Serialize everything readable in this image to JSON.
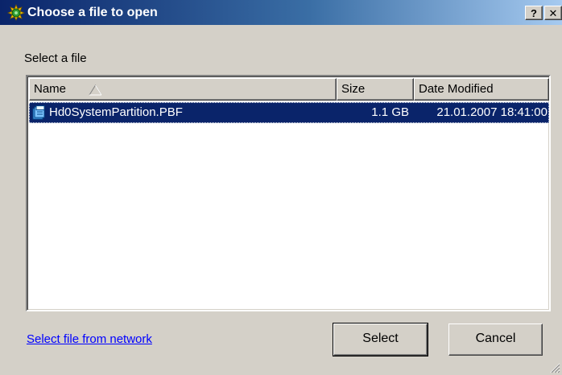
{
  "window": {
    "title": "Choose a file to open",
    "help_label": "?",
    "close_label": "✕"
  },
  "prompt": "Select a file",
  "list": {
    "columns": [
      {
        "label": "Name",
        "sort": "ascending"
      },
      {
        "label": "Size"
      },
      {
        "label": "Date Modified"
      }
    ],
    "rows": [
      {
        "name": "Hd0SystemPartition.PBF",
        "size": "1.1 GB",
        "date": "21.01.2007 18:41:00",
        "selected": true,
        "icon": "file-icon"
      }
    ]
  },
  "network_link": "Select file from network",
  "buttons": {
    "select": "Select",
    "cancel": "Cancel"
  },
  "colors": {
    "titlebar_start": "#0a246a",
    "titlebar_end": "#a6caf0",
    "selection": "#0a246a",
    "face": "#d4d0c8",
    "link": "#0000ff"
  }
}
